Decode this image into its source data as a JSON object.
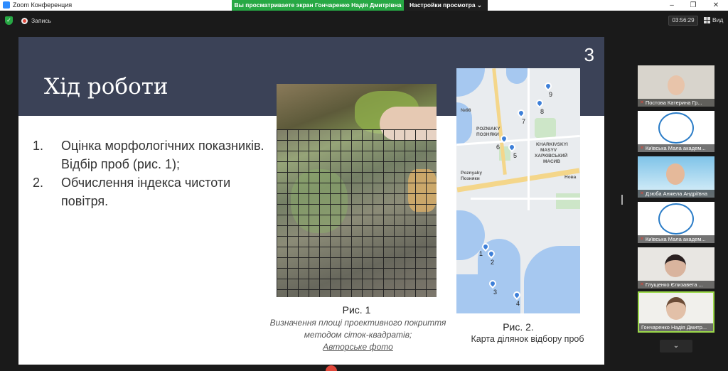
{
  "window": {
    "app_title": "Zoom Конференция",
    "share_banner": "Вы просматриваете экран Гончаренко Надія Дмитрівна",
    "view_options": "Настройки просмотра ⌄",
    "minimize": "–",
    "maximize": "❐",
    "close": "✕"
  },
  "toolbar": {
    "record_label": "Запись",
    "timer": "03:56:29",
    "view_label": "Вид"
  },
  "slide": {
    "title": "Хід роботи",
    "number": "3",
    "items": [
      {
        "num": "1.",
        "text": "Оцінка морфологічних показників. Відбір проб (рис. 1);"
      },
      {
        "num": "2.",
        "text": "Обчислення індекса чистоти повітря."
      }
    ],
    "fig1": {
      "label": "Рис. 1",
      "caption": "Визначення площі проективного покриття методом сіток-квадратів;",
      "credit": "Авторське фото"
    },
    "fig2": {
      "label": "Рис. 2.",
      "caption": "Карта ділянок відбору проб"
    },
    "map": {
      "labels": [
        "№98",
        "POZNIAKY",
        "ПОЗНЯКИ",
        "KHARKIVSKYI",
        "MASYV",
        "ХАРКІВСЬКИЙ",
        "МАСИВ",
        "Poznyaky",
        "Позняки",
        "Нова"
      ],
      "pins": [
        "1",
        "2",
        "3",
        "4",
        "5",
        "6",
        "7",
        "8",
        "9"
      ]
    }
  },
  "participants": [
    {
      "name": "Постова Катерина Гр...",
      "muted": true
    },
    {
      "name": "Київська Мала академ...",
      "muted": true
    },
    {
      "name": "Дзюба Анжела Андріївна",
      "muted": true
    },
    {
      "name": "Київська Мала академ...",
      "muted": true
    },
    {
      "name": "Глущенко Єлизавета ...",
      "muted": true
    },
    {
      "name": "Гончаренко Надія Дмитр...",
      "muted": false
    }
  ],
  "colors": {
    "share_banner": "#27a844",
    "slide_header": "#3b4257",
    "active_speaker": "#9cd94b",
    "map_pin": "#3d7fd8"
  }
}
